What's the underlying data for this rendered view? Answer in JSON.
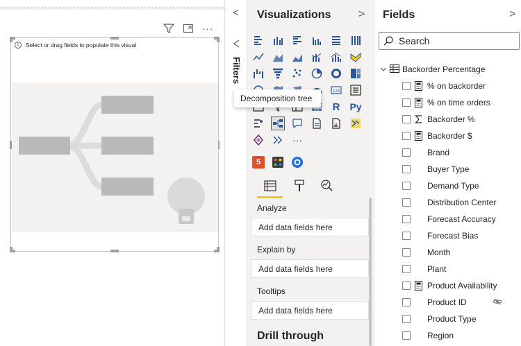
{
  "canvas": {
    "hint_text": "Select or drag fields to populate this visual",
    "tool_icons": [
      "filter-icon",
      "focus-mode-icon",
      "more-options-icon"
    ]
  },
  "collapse": {
    "chevron": "<",
    "filters_label": "Filters"
  },
  "visualizations": {
    "title": "Visualizations",
    "chevron": ">",
    "more_label": "···",
    "tooltip": "Decomposition tree",
    "tabs": [
      "build-visual-tab",
      "format-visual-tab",
      "analytics-tab"
    ],
    "sections": [
      {
        "label": "Analyze",
        "placeholder": "Add data fields here"
      },
      {
        "label": "Explain by",
        "placeholder": "Add data fields here"
      },
      {
        "label": "Tooltips",
        "placeholder": "Add data fields here"
      }
    ],
    "drill_through": "Drill through",
    "r_label": "R",
    "py_label": "Py",
    "html5_label": "5"
  },
  "fields": {
    "title": "Fields",
    "chevron": ">",
    "search_placeholder": "Search",
    "table_name": "Backorder Percentage",
    "items": [
      {
        "label": "% on backorder",
        "icon": "calculator-icon"
      },
      {
        "label": "% on time orders",
        "icon": "calculator-icon"
      },
      {
        "label": "Backorder %",
        "icon": "sigma-icon"
      },
      {
        "label": "Backorder $",
        "icon": "calculator-icon"
      },
      {
        "label": "Brand",
        "icon": ""
      },
      {
        "label": "Buyer Type",
        "icon": ""
      },
      {
        "label": "Demand Type",
        "icon": ""
      },
      {
        "label": "Distribution Center",
        "icon": ""
      },
      {
        "label": "Forecast Accuracy",
        "icon": ""
      },
      {
        "label": "Forecast Bias",
        "icon": ""
      },
      {
        "label": "Month",
        "icon": ""
      },
      {
        "label": "Plant",
        "icon": ""
      },
      {
        "label": "Product Availability",
        "icon": "calculator-icon"
      },
      {
        "label": "Product ID",
        "icon": "",
        "hidden": true
      },
      {
        "label": "Product Type",
        "icon": ""
      },
      {
        "label": "Region",
        "icon": ""
      }
    ]
  },
  "colors": {
    "accent": "#f2c811",
    "icon_blue": "#2b579a",
    "pane_bg": "#f3f2f1"
  }
}
